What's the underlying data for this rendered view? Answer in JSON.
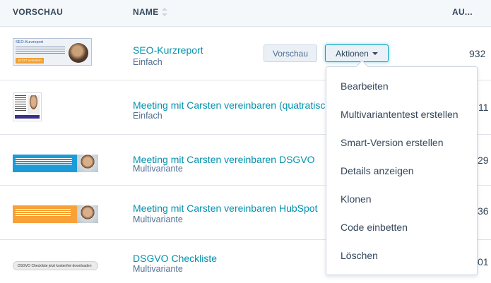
{
  "header": {
    "preview_label": "VORSCHAU",
    "name_label": "NAME",
    "au_label": "AU..."
  },
  "rows": [
    {
      "name": "SEO-Kurzreport",
      "type": "Einfach",
      "value": "932",
      "thumb_title": "SEO-Kurzreport",
      "thumb_cta": "JETZT anfordern"
    },
    {
      "name": "Meeting mit Carsten vereinbaren (quatratisch)",
      "type": "Einfach",
      "value": "11"
    },
    {
      "name": "Meeting mit Carsten vereinbaren DSGVO",
      "type": "Multivariante",
      "value": "29"
    },
    {
      "name": "Meeting mit Carsten vereinbaren HubSpot",
      "type": "Multivariante",
      "value": "36"
    },
    {
      "name": "DSGVO Checkliste",
      "type": "Multivariante",
      "value": "01",
      "thumb_text": "DSGVO Checkliste jetzt kostenfrei downloaden"
    }
  ],
  "row_actions": {
    "preview_label": "Vorschau",
    "actions_label": "Aktionen"
  },
  "actions_menu": [
    "Bearbeiten",
    "Multivariantentest erstellen",
    "Smart-Version erstellen",
    "Details anzeigen",
    "Klonen",
    "Code einbetten",
    "Löschen"
  ]
}
